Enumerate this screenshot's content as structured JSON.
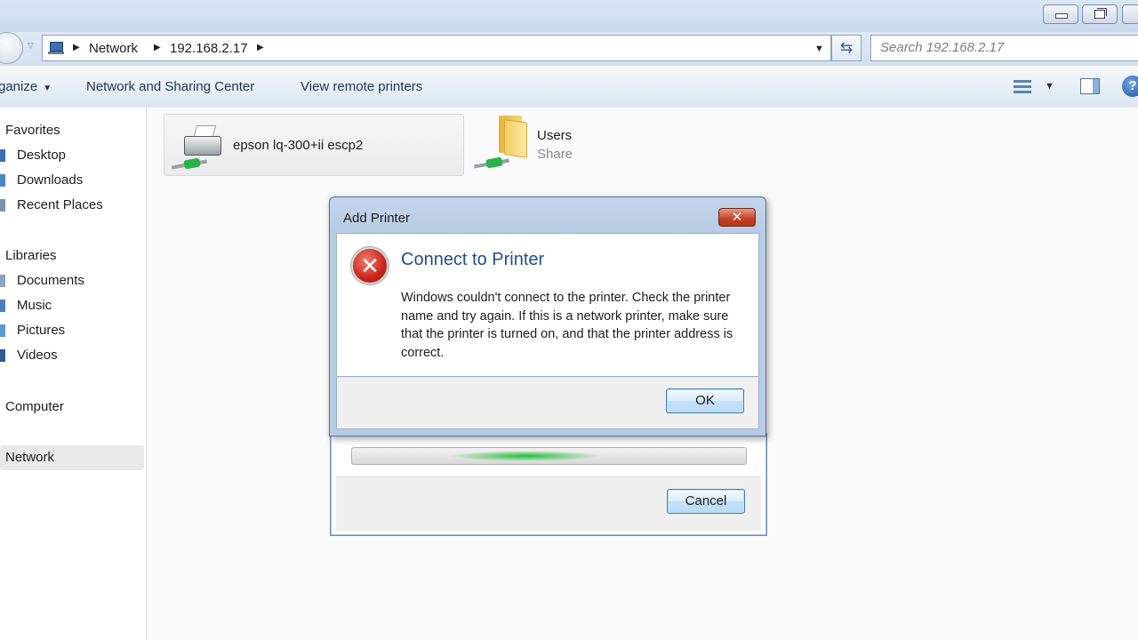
{
  "address_bar": {
    "crumbs": [
      "Network",
      "192.168.2.17"
    ],
    "search_placeholder": "Search 192.168.2.17"
  },
  "command_bar": {
    "organize": "ganize",
    "network_sharing": "Network and Sharing Center",
    "view_remote": "View remote printers"
  },
  "sidebar": {
    "favorites": "Favorites",
    "desktop": "Desktop",
    "downloads": "Downloads",
    "recent": "Recent Places",
    "libraries": "Libraries",
    "documents": "Documents",
    "music": "Music",
    "pictures": "Pictures",
    "videos": "Videos",
    "computer": "Computer",
    "network": "Network"
  },
  "content": {
    "printer_name": "epson lq-300+ii escp2",
    "share_name": "Users",
    "share_type": "Share"
  },
  "background_dialog": {
    "cancel": "Cancel"
  },
  "error_dialog": {
    "title": "Add Printer",
    "close": "✕",
    "heading": "Connect to Printer",
    "message": "Windows couldn't connect to the printer. Check the printer name and try again. If this is a network printer, make sure that the printer is turned on, and that the printer address is correct.",
    "ok": "OK"
  },
  "colors": {
    "heading": "#1f4e8f",
    "error_red": "#c9261a",
    "progress_green": "#22c23a"
  }
}
